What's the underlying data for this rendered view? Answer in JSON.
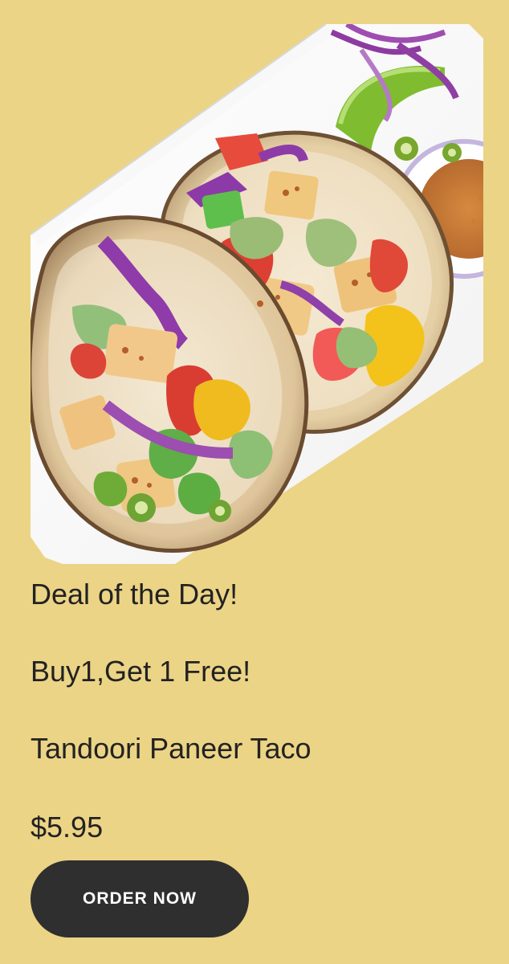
{
  "promo": {
    "headline": "Deal of the Day!",
    "offer": "Buy1,Get 1 Free!",
    "item_name": "Tandoori Paneer Taco",
    "price": "$5.95",
    "order_button_label": "ORDER NOW"
  },
  "colors": {
    "background": "#ecd486",
    "button": "#2f2f2f",
    "text": "#222222"
  }
}
